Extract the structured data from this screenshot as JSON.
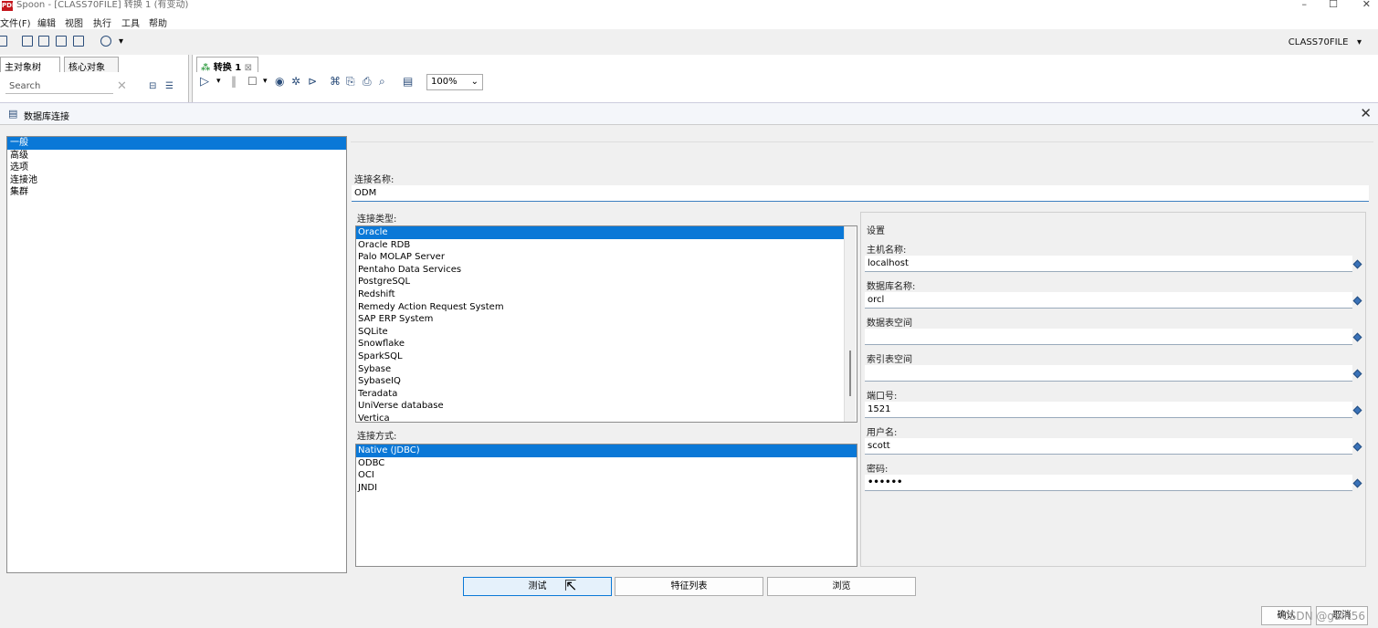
{
  "window": {
    "title": "Spoon - [CLASS70FILE] 转换 1 (有变动)",
    "app_icon": "PDI",
    "min": "–",
    "max": "☐",
    "close": "✕"
  },
  "menu": [
    "文件(F)",
    "编辑",
    "视图",
    "执行",
    "工具",
    "帮助"
  ],
  "toolbar": {
    "repository": "CLASS70FILE",
    "repo_arrow": "▾"
  },
  "left_tabs": [
    "主对象树",
    "核心对象"
  ],
  "search_placeholder": "Search",
  "canvas_tab": "转换 1",
  "zoom": "100%",
  "dialog": {
    "title": "数据库连接",
    "nav": [
      "一般",
      "高级",
      "选项",
      "连接池",
      "集群"
    ],
    "selected_nav": 0,
    "conn_name_label": "连接名称:",
    "conn_name": "ODM",
    "conn_type_label": "连接类型:",
    "conn_types": [
      "Oracle",
      "Oracle RDB",
      "Palo MOLAP Server",
      "Pentaho Data Services",
      "PostgreSQL",
      "Redshift",
      "Remedy Action Request System",
      "SAP ERP System",
      "SQLite",
      "Snowflake",
      "SparkSQL",
      "Sybase",
      "SybaseIQ",
      "Teradata",
      "UniVerse database",
      "Vertica"
    ],
    "selected_type": 0,
    "access_label": "连接方式:",
    "access_types": [
      "Native (JDBC)",
      "ODBC",
      "OCI",
      "JNDI"
    ],
    "selected_access": 0,
    "settings": {
      "title": "设置",
      "host_label": "主机名称:",
      "host": "localhost",
      "db_label": "数据库名称:",
      "db": "orcl",
      "tablespace_label": "数据表空间",
      "tablespace": "",
      "index_label": "索引表空间",
      "index": "",
      "port_label": "端口号:",
      "port": "1521",
      "user_label": "用户名:",
      "user": "scott",
      "pwd_label": "密码:",
      "pwd": "••••••"
    },
    "buttons": {
      "test": "测试",
      "features": "特征列表",
      "explore": "浏览",
      "ok": "确认",
      "cancel": "取消"
    }
  },
  "watermark": "CSDN @gailt56"
}
